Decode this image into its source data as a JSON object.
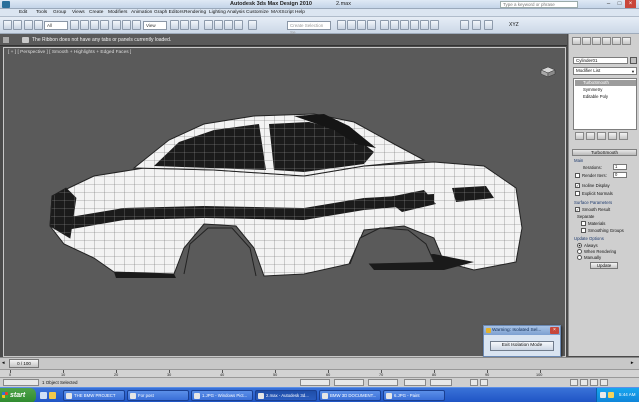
{
  "window": {
    "app_title": "Autodesk 3ds Max Design 2010",
    "file_title": "2.max",
    "search_placeholder": "Type a keyword or phrase"
  },
  "menu": [
    "Edit",
    "Tools",
    "Group",
    "Views",
    "Create",
    "Modifiers",
    "Animation",
    "Graph Editors",
    "Rendering",
    "Lighting Analysis",
    "Customize",
    "MAXScript",
    "Help"
  ],
  "toolbar": {
    "selection_filter": "All",
    "ref_coord": "View",
    "named_selection": "Create Selection Se",
    "xyz": "XYZ"
  },
  "ribbon": {
    "message": "The Ribbon does not have any tabs or panels currently loaded."
  },
  "viewport": {
    "label": "[ + ] [ Perspective ] [ Smooth + Highlights + Edged Faces ]"
  },
  "command_panel": {
    "object_name": "Cylinder01",
    "modifier_list": "Modifier List",
    "stack": [
      "TurboSmooth",
      "Symmetry",
      "Editable Poly"
    ],
    "turbosmooth": {
      "rollout": "TurboSmooth",
      "main": "Main",
      "iterations_label": "Iterations:",
      "iterations_value": "1",
      "render_iters_label": "Render Iters:",
      "render_iters_value": "0",
      "isoline": "Isoline Display",
      "explicit_normals": "Explicit Normals",
      "surface_parameters": "Surface Parameters",
      "smooth_result": "Smooth Result",
      "separate": "Separate",
      "materials": "Materials",
      "smoothing_groups": "Smoothing Groups",
      "update_options": "Update Options",
      "always": "Always",
      "when_rendering": "When Rendering",
      "manually": "Manually",
      "update": "Update"
    }
  },
  "warning": {
    "title": "Warning: Isolated Sel...",
    "button": "Exit Isolation Mode"
  },
  "time_slider": {
    "label": "0 / 100"
  },
  "trackbar": {
    "ticks": [
      "0",
      "10",
      "20",
      "30",
      "40",
      "50",
      "60",
      "70",
      "80",
      "90",
      "100"
    ]
  },
  "status": {
    "text": "1 Object Selected"
  },
  "taskbar": {
    "start": "start",
    "tasks": [
      "THE BMW PROJECT",
      "For post",
      "1.JPG - Windows Pict...",
      "2.max - Autodesk 3d...",
      "BMW 3D DOCUMENT...",
      "6.JPG - Paint"
    ],
    "clock": "5:44 AM"
  }
}
